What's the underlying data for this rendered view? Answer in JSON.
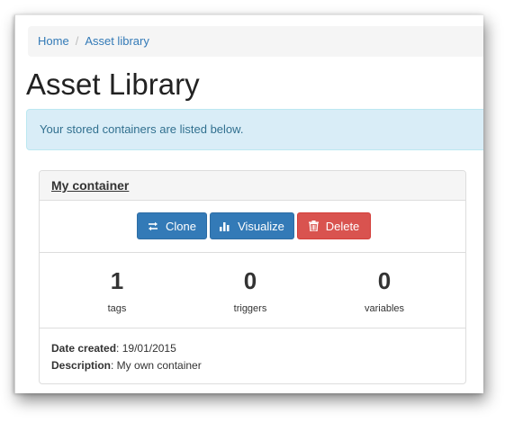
{
  "breadcrumb": {
    "home": "Home",
    "separator": "/",
    "current": "Asset library"
  },
  "page": {
    "title": "Asset Library"
  },
  "alert": {
    "text": "Your stored containers are listed below."
  },
  "container": {
    "name": "My container",
    "buttons": {
      "clone": "Clone",
      "visualize": "Visualize",
      "delete": "Delete"
    },
    "stats": [
      {
        "value": "1",
        "label": "tags"
      },
      {
        "value": "0",
        "label": "triggers"
      },
      {
        "value": "0",
        "label": "variables"
      }
    ],
    "date_label": "Date created",
    "date_value": ": 19/01/2015",
    "description_label": "Description",
    "description_value": ": My own container"
  },
  "icons": {
    "clone": "swap-arrows-icon",
    "visualize": "bar-chart-icon",
    "delete": "trash-icon"
  },
  "colors": {
    "primary": "#337ab7",
    "danger": "#d9534f",
    "alert_bg": "#d9edf7"
  }
}
